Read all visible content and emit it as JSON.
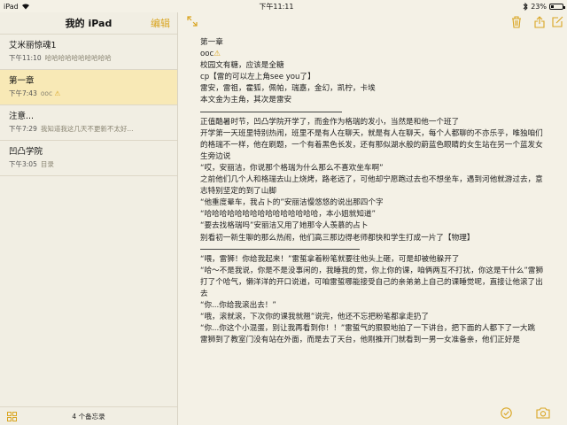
{
  "status": {
    "device": "iPad",
    "time": "下午11:11",
    "battery": "23%",
    "battery_level": 0.23
  },
  "sidebar": {
    "title": "我的 iPad",
    "edit_label": "编辑",
    "notes": [
      {
        "title": "艾米丽惊魂1",
        "time": "下午11:10",
        "preview": "哈哈哈哈哈哈哈哈哈哈"
      },
      {
        "title": "第一章",
        "time": "下午7:43",
        "preview": "ooc"
      },
      {
        "title": "注意...",
        "time": "下午7:29",
        "preview": "我知道我这几天不更新不太好..."
      },
      {
        "title": "凹凸学院",
        "time": "下午3:05",
        "preview": "目录"
      }
    ],
    "count_label": "4 个备忘录"
  },
  "icons": {
    "expand": "expand-arrows-icon",
    "trash": "trash-icon",
    "share": "share-icon",
    "compose": "compose-icon",
    "checklist": "checklist-icon",
    "camera": "camera-icon",
    "accent": "#d9a521"
  },
  "note": {
    "lines": [
      "第一章",
      "ooc",
      "校园文有糖，应该是全糖",
      "cp【雷的可以左上角see you了】",
      "雷安，雷祖，霍狐，佩帕，瑞嘉，金幻，凯柠，卡埃",
      "本文金为主角，其次是雷安",
      "正值酷暑时节，凹凸学院开学了，而金作为格瑞的发小，当然是和他一个班了",
      "开学第一天班里特别热闹，班里不是有人在聊天，就是有人在聊天，每个人都聊的不亦乐乎，唯独咱们的格瑞不一样，他在刷题，一个有着黑色长发，还有那似湖水般的蔚蓝色眼睛的女生站在另一个蓝发女生旁边说",
      "“哎，安丽洁，你说那个格瑞为什么那么不喜欢坐车啊”",
      "之前他们几个人和格瑞去山上烧烤，路老远了，可他却宁愿跑过去也不想坐车，遇到河他就游过去，意志特别坚定的到了山脚",
      "“他重度晕车，我占卜的”安丽洁慢悠悠的说出那四个字",
      "“哈哈哈哈哈哈哈哈哈哈哈哈哈哈哈，本小姐就知道”",
      "“要去找格瑞吗”安丽洁又用了她那令人羡慕的占卜",
      "别看初一新生聊的那么热闹，他们高三那边得老师都快和学生打成一片了【物理】",
      "“喂，雷狮！你给我起来！”雷蜇拿着粉笔就要往他头上砸，可是却被他躲开了",
      "“哈～不是我说，你是不是没事闲的，我睡我的觉，你上你的课，咱俩两互不打扰，你这是干什么”雷狮打了个哈气，懒洋洋的开口说道，可咱雷蜇哪能接受自己的亲弟弟上自己的课睡觉呢，直接让他滚了出去",
      "“你...你给我滚出去！”",
      "“哦，滚就滚，下次你的课我就翘”说完，他还不忘把粉笔都拿走扔了",
      "“你...你这个小混蛋，别让我再看到你！！”雷蜇气的狠狠地拍了一下讲台，把下面的人都下了一大跳",
      "雷狮到了教室门没有站在外面，而是去了天台，他刚推开门就看到一男一女准备亲，他们正好是"
    ]
  }
}
